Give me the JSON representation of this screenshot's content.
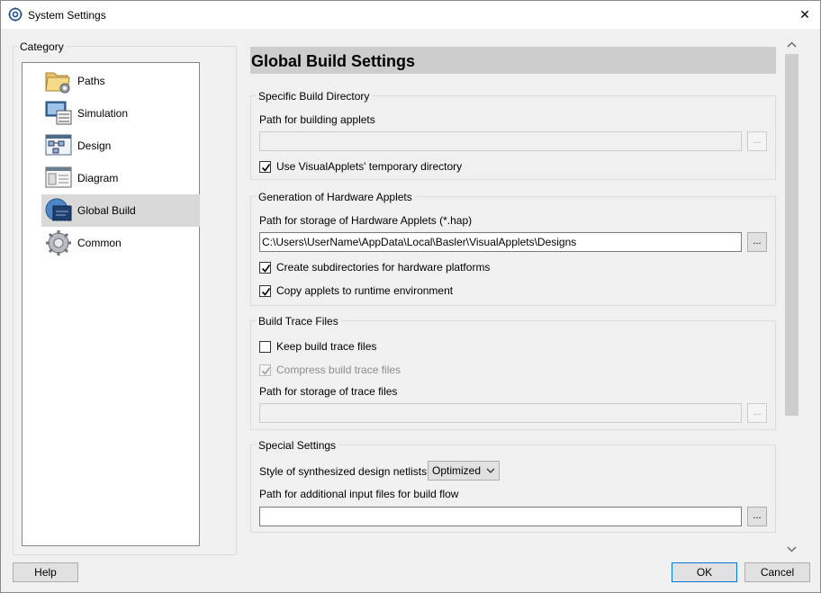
{
  "window": {
    "title": "System Settings",
    "close_glyph": "✕"
  },
  "category": {
    "label": "Category",
    "items": [
      {
        "label": "Paths",
        "icon": "folder-gear-icon"
      },
      {
        "label": "Simulation",
        "icon": "simulation-icon"
      },
      {
        "label": "Design",
        "icon": "design-icon"
      },
      {
        "label": "Diagram",
        "icon": "diagram-icon"
      },
      {
        "label": "Global Build",
        "icon": "chip-icon",
        "selected": true
      },
      {
        "label": "Common",
        "icon": "gear-icon"
      }
    ]
  },
  "main": {
    "heading": "Global Build Settings",
    "specific": {
      "title": "Specific Build Directory",
      "path_label": "Path for building applets",
      "path_value": "",
      "browse_label": "...",
      "use_temp_label": "Use VisualApplets' temporary directory",
      "use_temp_checked": true
    },
    "hardware": {
      "title": "Generation of Hardware Applets",
      "path_label": "Path for storage of Hardware Applets (*.hap)",
      "path_value": "C:\\Users\\UserName\\AppData\\Local\\Basler\\VisualApplets\\Designs",
      "browse_label": "...",
      "subdir_label": "Create subdirectories for hardware platforms",
      "subdir_checked": true,
      "copy_label": "Copy applets to runtime environment",
      "copy_checked": true
    },
    "trace": {
      "title": "Build Trace Files",
      "keep_label": "Keep build trace files",
      "keep_checked": false,
      "compress_label": "Compress build trace files",
      "compress_checked": true,
      "path_label": "Path for storage of trace files",
      "path_value": "",
      "browse_label": "..."
    },
    "special": {
      "title": "Special Settings",
      "style_label": "Style of synthesized design netlists",
      "style_value": "Optimized",
      "input_label": "Path for additional input files for build flow",
      "input_value": "",
      "browse_label": "..."
    }
  },
  "buttons": {
    "help": "Help",
    "ok": "OK",
    "cancel": "Cancel"
  }
}
